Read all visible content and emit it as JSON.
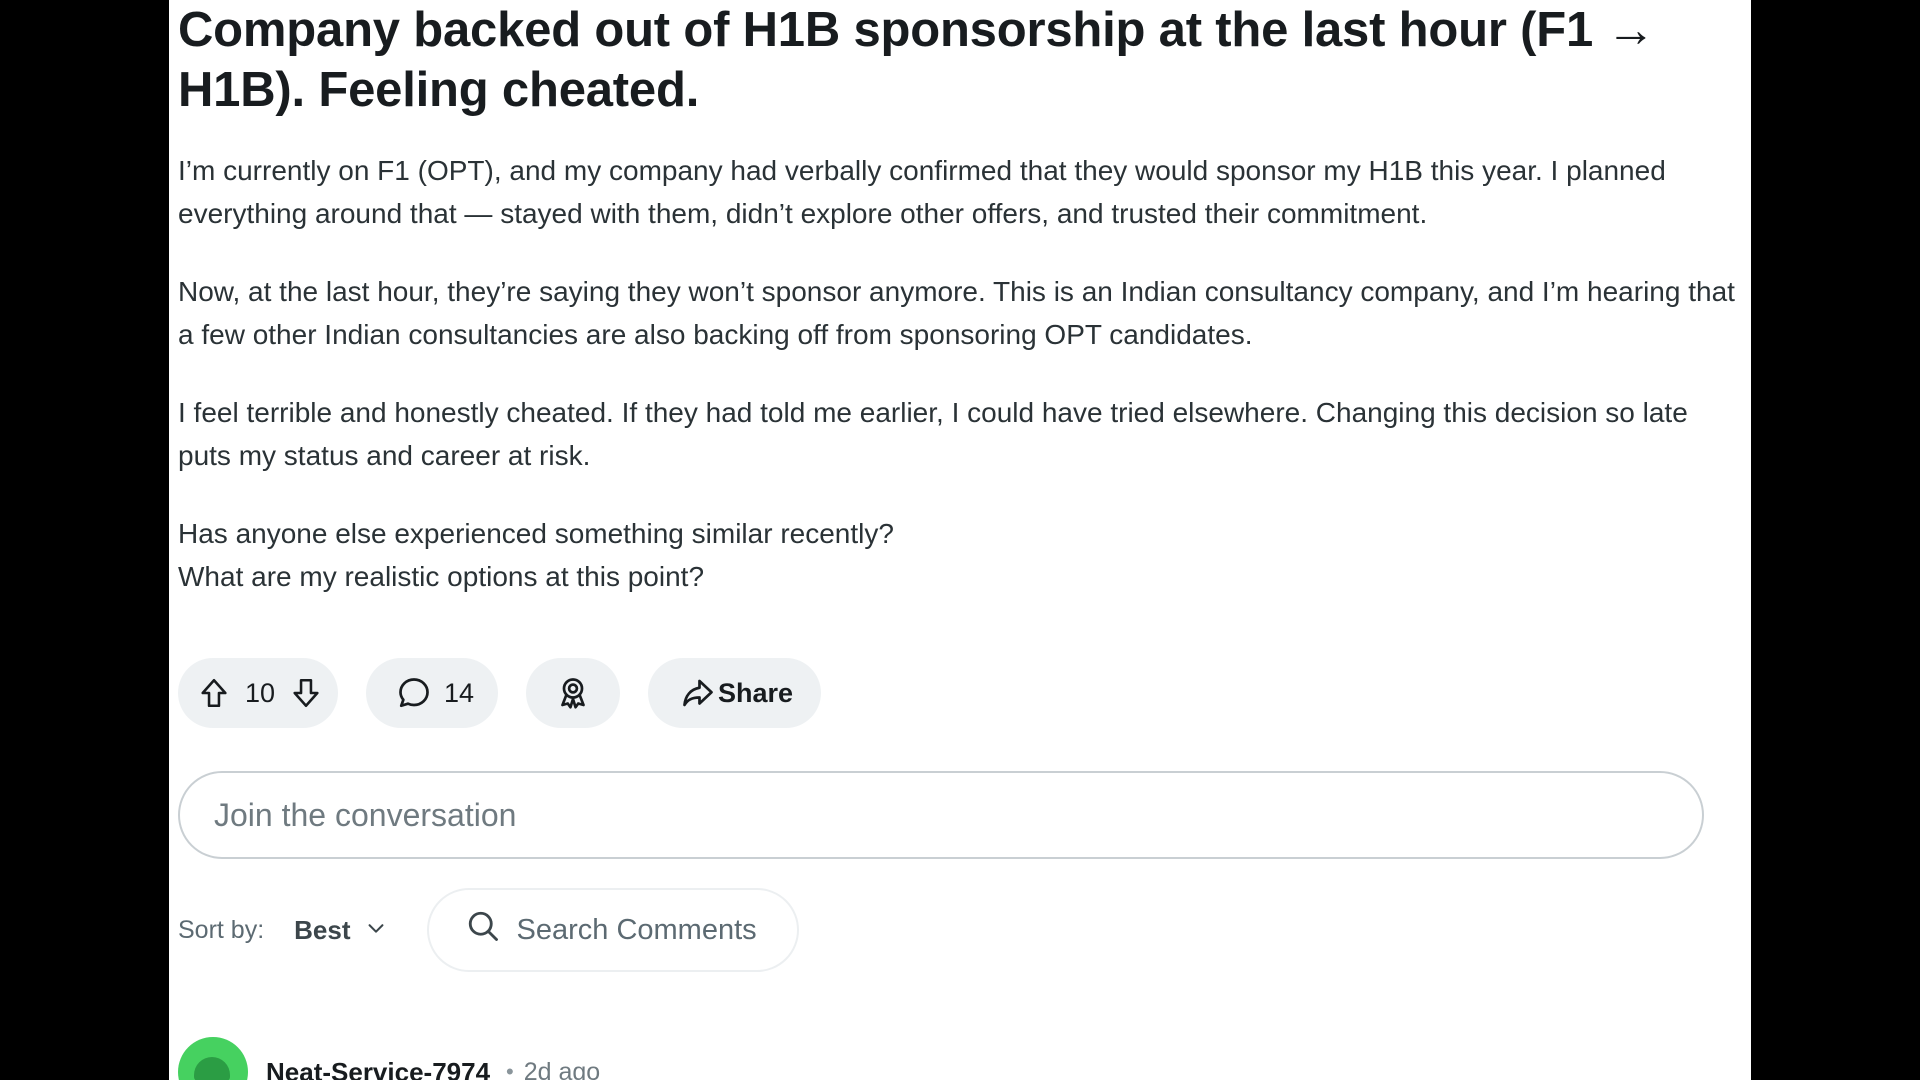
{
  "post": {
    "title": "Company backed out of H1B sponsorship at the last hour (F1 → H1B). Feeling cheated.",
    "body": [
      "I’m currently on F1 (OPT), and my company had verbally confirmed that they would sponsor my H1B this year. I planned everything around that — stayed with them, didn’t explore other offers, and trusted their commitment.",
      "Now, at the last hour, they’re saying they won’t sponsor anymore. This is an Indian consultancy company, and I’m hearing that a few other Indian consultancies are also backing off from sponsoring OPT candidates.",
      "I feel terrible and honestly cheated. If they had told me earlier, I could have tried elsewhere. Changing this decision so late puts my status and career at risk.",
      "Has anyone else experienced something similar recently?\nWhat are my realistic options at this point?"
    ]
  },
  "actions": {
    "vote_count": "10",
    "comment_count": "14",
    "share_label": "Share",
    "icons": {
      "upvote": "upvote-arrow-icon",
      "downvote": "downvote-arrow-icon",
      "comment": "comment-bubble-icon",
      "award": "award-icon",
      "share": "share-arrow-icon"
    }
  },
  "comment_box": {
    "placeholder": "Join the conversation"
  },
  "sort": {
    "label": "Sort by:",
    "selected": "Best"
  },
  "search": {
    "label": "Search Comments"
  },
  "first_comment": {
    "username": "Neat-Service-7974",
    "separator": "•",
    "time": "2d ago"
  },
  "colors": {
    "page_background": "#000000",
    "content_background": "#ffffff",
    "pill_background": "#eef1f3",
    "title_text": "#181c1f",
    "body_text": "#2a3236",
    "avatar": "#46d160"
  }
}
